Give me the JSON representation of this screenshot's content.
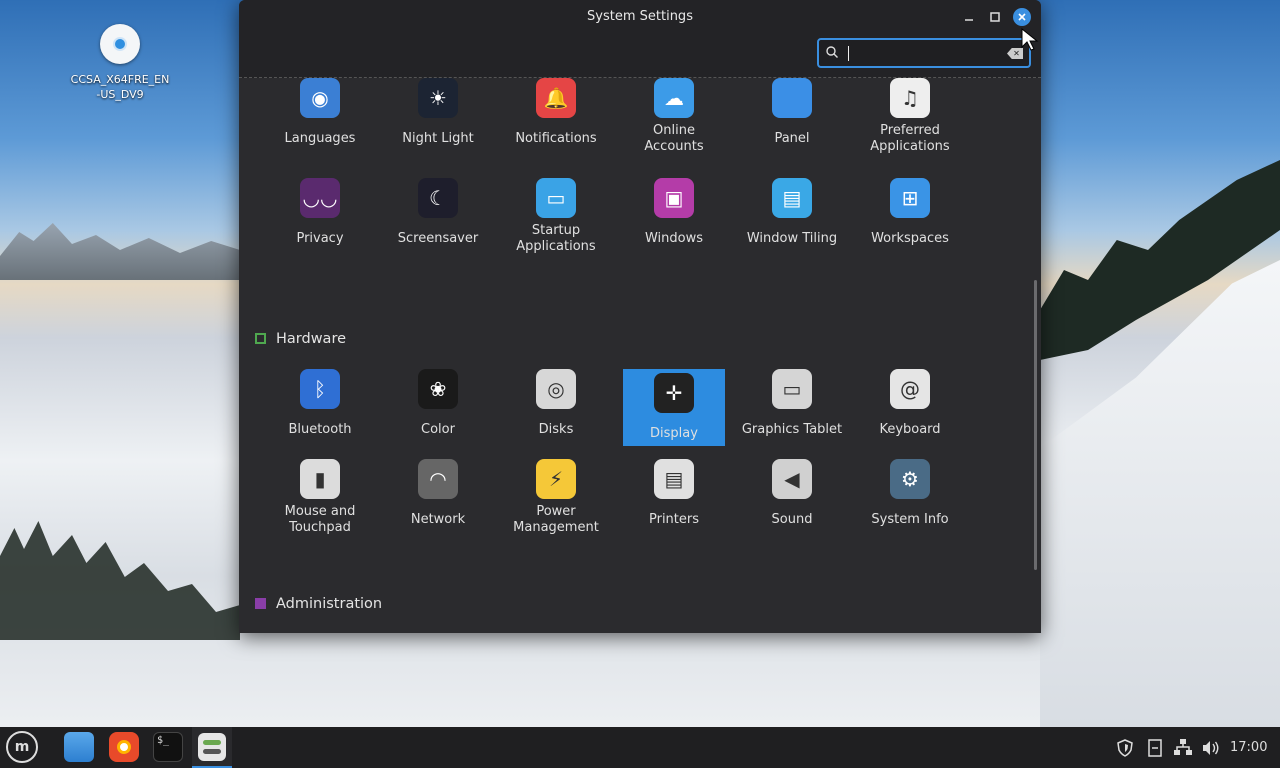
{
  "desktop": {
    "icon_label": "CCSA_X64FRE_EN-US_DV9"
  },
  "window": {
    "title": "System Settings",
    "search": {
      "value": "",
      "placeholder": ""
    }
  },
  "top_items": [
    {
      "label": "Languages",
      "icon": "languages-icon",
      "color": "#3b7fd4"
    },
    {
      "label": "Night Light",
      "icon": "night-light-icon",
      "color": "#1c2433"
    },
    {
      "label": "Notifications",
      "icon": "notifications-icon",
      "color": "#e54545"
    },
    {
      "label": "Online\nAccounts",
      "icon": "online-accounts-icon",
      "color": "#3c9be8"
    },
    {
      "label": "Panel",
      "icon": "panel-icon",
      "color": "#3b8fe6"
    },
    {
      "label": "Preferred\nApplications",
      "icon": "preferred-applications-icon",
      "color": "#eeeeee"
    },
    {
      "label": "Privacy",
      "icon": "privacy-icon",
      "color": "#5a2a6e"
    },
    {
      "label": "Screensaver",
      "icon": "screensaver-icon",
      "color": "#1e1e2c"
    },
    {
      "label": "Startup\nApplications",
      "icon": "startup-applications-icon",
      "color": "#3aa3e6"
    },
    {
      "label": "Windows",
      "icon": "windows-icon",
      "color": "#b43ca8"
    },
    {
      "label": "Window Tiling",
      "icon": "window-tiling-icon",
      "color": "#3aa8e6"
    },
    {
      "label": "Workspaces",
      "icon": "workspaces-icon",
      "color": "#3a94e6"
    }
  ],
  "hardware": {
    "heading": "Hardware",
    "items": [
      {
        "label": "Bluetooth",
        "icon": "bluetooth-icon",
        "color": "#2f6fd4"
      },
      {
        "label": "Color",
        "icon": "color-icon",
        "color": "#1a1a1a"
      },
      {
        "label": "Disks",
        "icon": "disks-icon",
        "color": "#d7d7d7"
      },
      {
        "label": "Display",
        "icon": "display-icon",
        "color": "#222222",
        "selected": true
      },
      {
        "label": "Graphics Tablet",
        "icon": "graphics-tablet-icon",
        "color": "#d5d5d5"
      },
      {
        "label": "Keyboard",
        "icon": "keyboard-icon",
        "color": "#e5e5e5"
      },
      {
        "label": "Mouse and\nTouchpad",
        "icon": "mouse-icon",
        "color": "#dcdcdc"
      },
      {
        "label": "Network",
        "icon": "network-icon",
        "color": "#666666"
      },
      {
        "label": "Power\nManagement",
        "icon": "power-management-icon",
        "color": "#f5c838"
      },
      {
        "label": "Printers",
        "icon": "printers-icon",
        "color": "#e0e0e0"
      },
      {
        "label": "Sound",
        "icon": "sound-icon",
        "color": "#d0d0d0"
      },
      {
        "label": "System Info",
        "icon": "system-info-icon",
        "color": "#4a6b86"
      }
    ]
  },
  "administration": {
    "heading": "Administration"
  },
  "taskbar": {
    "apps": [
      "menu-icon",
      "files-icon",
      "firefox-icon",
      "terminal-icon",
      "settings-icon"
    ],
    "clock": "17:00"
  }
}
